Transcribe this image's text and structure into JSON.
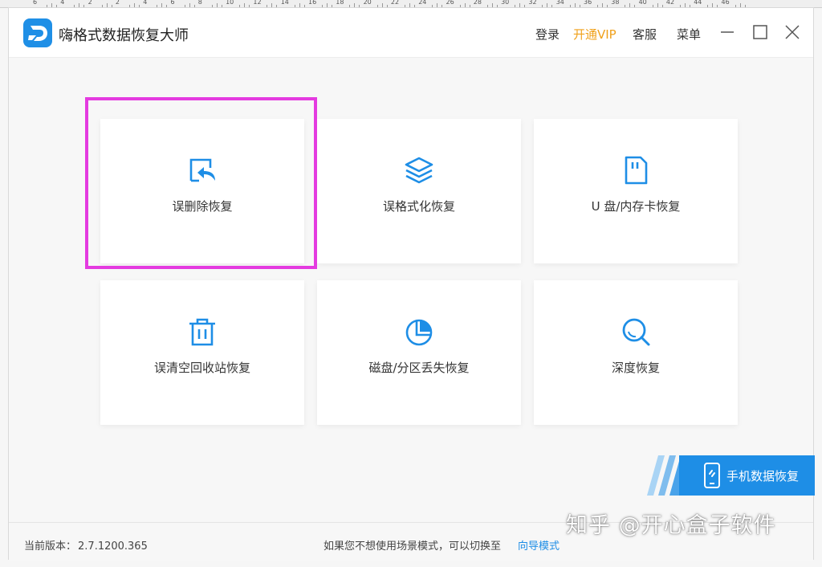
{
  "ruler": {
    "labels": [
      "6",
      "4",
      "2",
      "2",
      "4",
      "6",
      "8",
      "10",
      "12",
      "14",
      "16",
      "18",
      "20",
      "22",
      "24",
      "26",
      "28",
      "30",
      "32",
      "34",
      "36",
      "38",
      "40",
      "42",
      "44",
      "46"
    ]
  },
  "app": {
    "title": "嗨格式数据恢复大师",
    "accent_color": "#1e8ee6",
    "vip_color": "#f0a11b",
    "highlight_color": "#e43be0"
  },
  "header": {
    "login": "登录",
    "vip": "开通VIP",
    "service": "客服",
    "menu": "菜单"
  },
  "cards": [
    {
      "label": "误删除恢复",
      "icon": "file-restore-icon"
    },
    {
      "label": "误格式化恢复",
      "icon": "layers-icon"
    },
    {
      "label": "U 盘/内存卡恢复",
      "icon": "sd-card-icon"
    },
    {
      "label": "误清空回收站恢复",
      "icon": "trash-icon"
    },
    {
      "label": "磁盘/分区丢失恢复",
      "icon": "pie-chart-icon"
    },
    {
      "label": "深度恢复",
      "icon": "magnifier-icon"
    }
  ],
  "mobile": {
    "label": "手机数据恢复",
    "icon": "phone-icon"
  },
  "footer": {
    "version_label": "当前版本：",
    "version": "2.7.1200.365",
    "hint": "如果您不想使用场景模式，可以切换至",
    "guide_link": "向导模式"
  },
  "watermark": "知乎 @开心盒子软件"
}
